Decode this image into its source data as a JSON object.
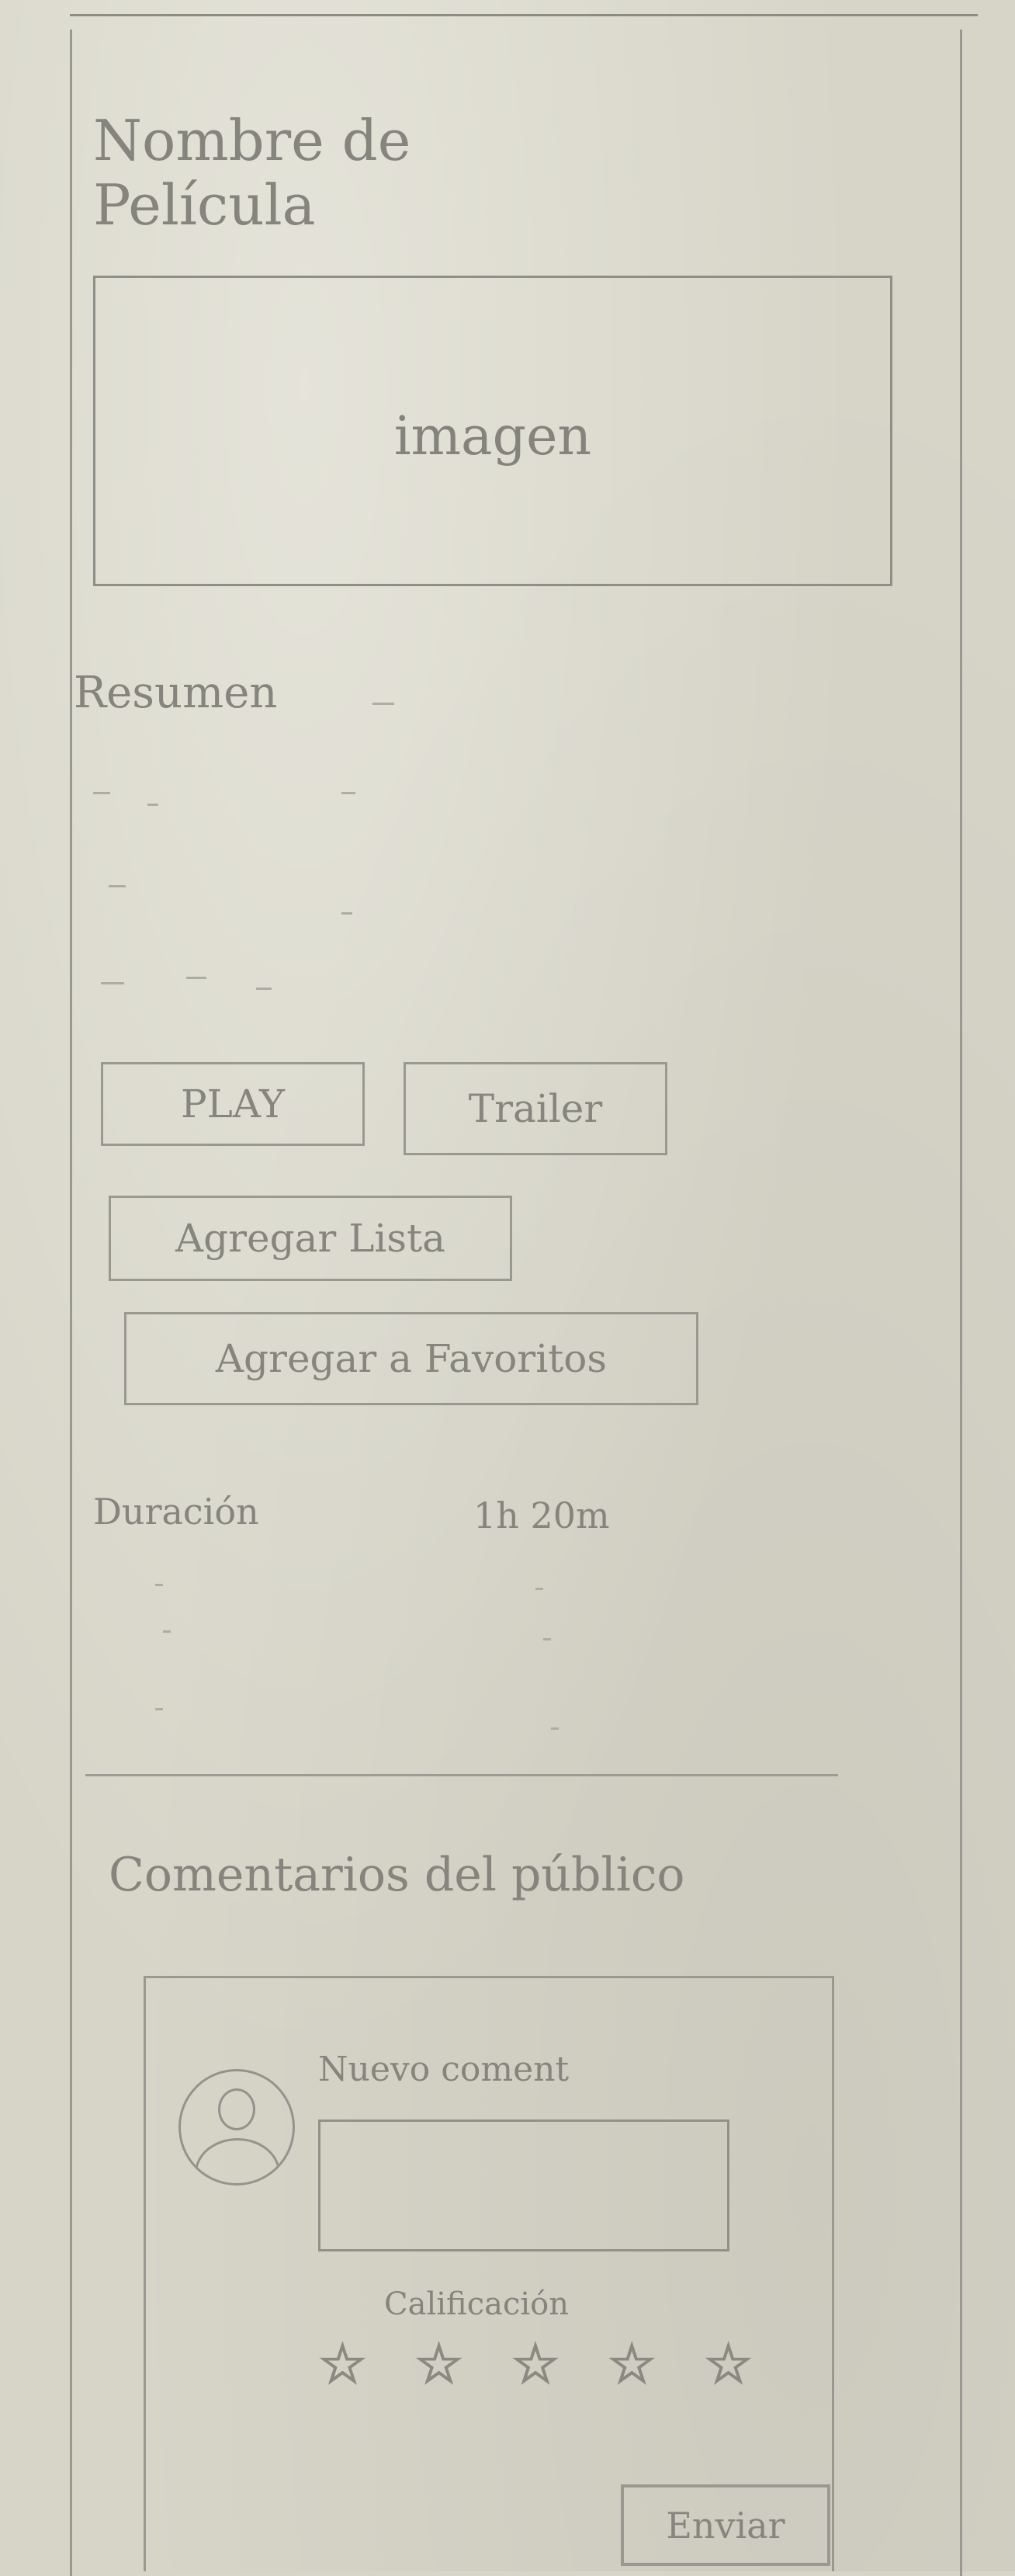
{
  "movie": {
    "title": "Nombre de Película",
    "image_label": "imagen"
  },
  "summary": {
    "label": "Resumen"
  },
  "actions": {
    "play_label": "PLAY",
    "trailer_label": "Trailer",
    "add_list_label": "Agregar Lista",
    "add_favorites_label": "Agregar a Favoritos"
  },
  "info": {
    "label": "Duración",
    "value": "1h 20m"
  },
  "comments": {
    "section_title": "Comentarios del público",
    "new_comment_label": "Nuevo coment",
    "comment_value": "",
    "rating_label": "Calificación",
    "rating_max": 5,
    "send_label": "Enviar"
  },
  "colors": {
    "paper": "#d7d5c8",
    "pencil": "#85847d"
  },
  "icons": {
    "avatar": "user-avatar-icon",
    "star": "star-outline-icon"
  }
}
